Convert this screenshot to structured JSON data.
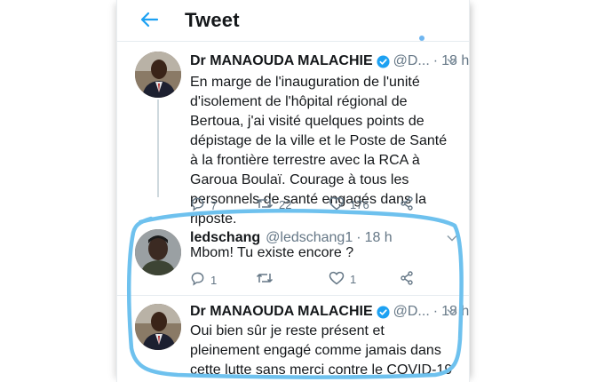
{
  "header": {
    "title": "Tweet",
    "back_icon": "back-arrow-icon"
  },
  "accent_color": "#1da1f2",
  "highlight_color": "#6ec1ee",
  "tweets": [
    {
      "name": "Dr MANAOUDA MALACHIE",
      "verified": true,
      "handle": "@D...",
      "sep": "·",
      "time": "18 h",
      "text": "En marge de l'inauguration de l'unité d'isolement de l'hôpital régional de Bertoua, j'ai visité quelques points de dépistage de la ville et le Poste de Santé à la frontière terrestre avec la RCA à Garoua Boulaï. Courage à tous les personnels de santé engagés dans la riposte.",
      "reply_count": "7",
      "retweet_count": "22",
      "like_count": "176"
    },
    {
      "name": "ledschang",
      "verified": false,
      "handle": "@ledschang1",
      "sep": "·",
      "time": "18 h",
      "text": "Mbom! Tu existe encore ?",
      "reply_count": "1",
      "retweet_count": "",
      "like_count": "1"
    },
    {
      "name": "Dr MANAOUDA MALACHIE",
      "verified": true,
      "handle": "@D...",
      "sep": "·",
      "time": "18 h",
      "text": "Oui bien sûr je reste présent et pleinement engagé comme jamais dans cette lutte sans merci contre le COVID-19"
    }
  ]
}
